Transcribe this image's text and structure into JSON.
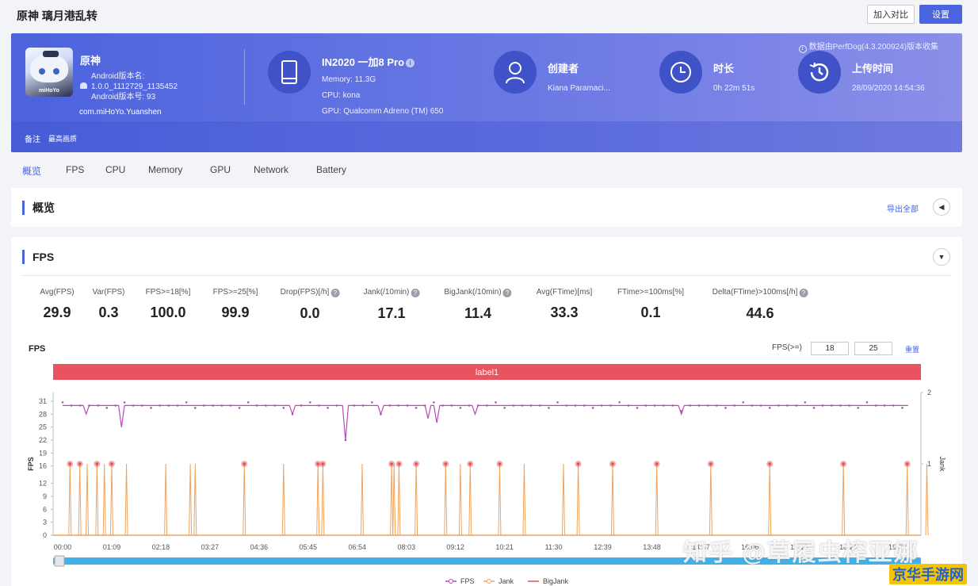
{
  "header": {
    "title": "原神 璃月港乱转",
    "compare_label": "加入对比",
    "settings_label": "设置"
  },
  "banner": {
    "collected_note": "数据由PerfDog(4.3.200924)版本收集",
    "app": {
      "name": "原神",
      "icon_brand": "miHoYo",
      "version_name_label": "Android版本名:",
      "version_name": "1.0.0_1112729_1135452",
      "version_code": "Android版本号: 93",
      "package": "com.miHoYo.Yuanshen"
    },
    "device": {
      "model": "IN2020 一加8 Pro",
      "memory": "Memory: 11.3G",
      "cpu": "CPU: kona",
      "gpu": "GPU: Qualcomm Adreno (TM) 650"
    },
    "creator": {
      "title": "创建者",
      "value": "Kiana Paramaci..."
    },
    "duration": {
      "title": "时长",
      "value": "0h 22m 51s"
    },
    "upload": {
      "title": "上传时间",
      "value": "28/09/2020 14:54:36"
    },
    "note_label": "备注",
    "note_value": "最高画质"
  },
  "tabs": [
    "概览",
    "FPS",
    "CPU",
    "Memory",
    "GPU",
    "Network",
    "Battery"
  ],
  "overview": {
    "title": "概览",
    "export_label": "导出全部"
  },
  "fps_section": {
    "title": "FPS",
    "stats": [
      {
        "label": "Avg(FPS)",
        "value": "29.9",
        "help": false
      },
      {
        "label": "Var(FPS)",
        "value": "0.3",
        "help": false
      },
      {
        "label": "FPS>=18[%]",
        "value": "100.0",
        "help": false
      },
      {
        "label": "FPS>=25[%]",
        "value": "99.9",
        "help": false
      },
      {
        "label": "Drop(FPS)[/h]",
        "value": "0.0",
        "help": true
      },
      {
        "label": "Jank(/10min)",
        "value": "17.1",
        "help": true
      },
      {
        "label": "BigJank(/10min)",
        "value": "11.4",
        "help": true
      },
      {
        "label": "Avg(FTime)[ms]",
        "value": "33.3",
        "help": false
      },
      {
        "label": "FTime>=100ms[%]",
        "value": "0.1",
        "help": false
      },
      {
        "label": "Delta(FTime)>100ms[/h]",
        "value": "44.6",
        "help": true
      }
    ],
    "chart_title": "FPS",
    "threshold_label": "FPS(>=)",
    "threshold_low": "18",
    "threshold_high": "25",
    "reset_label": "重置"
  },
  "chart_data": {
    "type": "line",
    "label_band": "label1",
    "x_ticks": [
      "00:00",
      "01:09",
      "02:18",
      "03:27",
      "04:36",
      "05:45",
      "06:54",
      "08:03",
      "09:12",
      "10:21",
      "11:30",
      "12:39",
      "13:48",
      "14:57",
      "16:06",
      "17:15",
      "18:24",
      "19:33"
    ],
    "y_left": {
      "label": "FPS",
      "ticks": [
        0,
        3,
        6,
        9,
        12,
        16,
        19,
        22,
        25,
        28,
        31
      ],
      "range": [
        0,
        33
      ]
    },
    "y_right": {
      "label": "Jank",
      "ticks": [
        1,
        2
      ],
      "range": [
        0,
        2
      ]
    },
    "legend": [
      {
        "name": "FPS",
        "color": "#b64bb8"
      },
      {
        "name": "Jank",
        "color": "#f0a35e"
      },
      {
        "name": "BigJank",
        "color": "#e45050"
      }
    ],
    "series": [
      {
        "name": "FPS",
        "baseline": 30,
        "dips": [
          [
            0.5,
            28
          ],
          [
            1.2,
            25
          ],
          [
            4.7,
            28
          ],
          [
            5.76,
            22
          ],
          [
            6.5,
            28
          ],
          [
            7.45,
            27
          ],
          [
            7.6,
            26
          ],
          [
            8.4,
            28
          ],
          [
            12.6,
            28
          ],
          [
            18.6,
            26
          ],
          [
            19.0,
            27
          ]
        ]
      },
      {
        "name": "Jank",
        "spikes": [
          0.15,
          0.35,
          0.5,
          0.7,
          0.85,
          1.0,
          1.3,
          2.1,
          2.6,
          2.7,
          3.7,
          4.5,
          5.2,
          5.3,
          6.1,
          6.7,
          6.75,
          6.85,
          7.2,
          7.8,
          8.1,
          8.3,
          8.9,
          9.4,
          10.2,
          10.5,
          11.2,
          12.1,
          13.2,
          14.4,
          15.9,
          17.2,
          17.6,
          19.5,
          19.8,
          20.2
        ]
      },
      {
        "name": "BigJank",
        "spikes": [
          0.15,
          0.35,
          0.7,
          1.0,
          3.7,
          5.2,
          5.3,
          6.7,
          6.85,
          7.2,
          7.8,
          8.3,
          8.9,
          10.5,
          11.2,
          12.1,
          13.2,
          14.4,
          15.9,
          17.2,
          19.5,
          19.8,
          20.2
        ]
      }
    ]
  },
  "watermarks": {
    "zhihu": "知乎 @草履虫榨亚娜",
    "site": "京华手游网"
  }
}
